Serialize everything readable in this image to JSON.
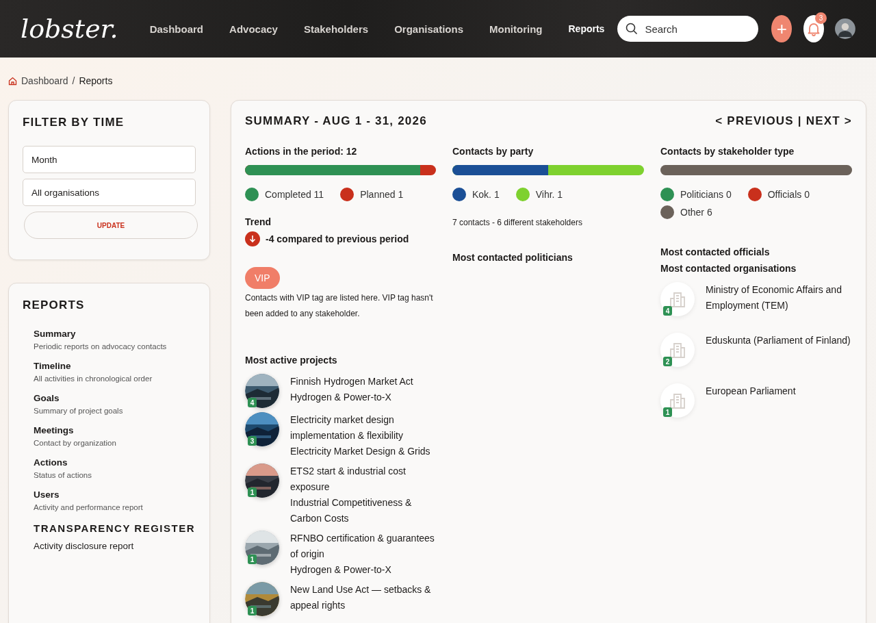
{
  "header": {
    "logo": "lobster.",
    "nav": [
      {
        "label": "Dashboard",
        "selected": false
      },
      {
        "label": "Advocacy",
        "selected": false
      },
      {
        "label": "Stakeholders",
        "selected": false
      },
      {
        "label": "Organisations",
        "selected": false
      },
      {
        "label": "Monitoring",
        "selected": false
      },
      {
        "label": "Reports",
        "selected": true
      }
    ],
    "search": {
      "placeholder": "Search"
    },
    "add_button": "+",
    "notification_count": "3"
  },
  "breadcrumb": [
    "Dashboard",
    "/",
    "Reports"
  ],
  "filter": {
    "title": "FILTER BY TIME",
    "fields": [
      "Month",
      "All organisations"
    ],
    "button": "UPDATE"
  },
  "reports": {
    "title": "REPORTS",
    "items": [
      {
        "title": "Summary",
        "subtitle": "Periodic reports on advocacy contacts"
      },
      {
        "title": "Timeline",
        "subtitle": "All activities in chronological order"
      },
      {
        "title": "Goals",
        "subtitle": "Summary of project goals"
      },
      {
        "title": "Meetings",
        "subtitle": "Contact by organization"
      },
      {
        "title": "Actions",
        "subtitle": "Status of actions"
      },
      {
        "title": "Users",
        "subtitle": "Activity and performance report"
      }
    ],
    "section_title": "TRANSPARENCY REGISTER",
    "section_items": [
      "Activity disclosure report"
    ]
  },
  "summary": {
    "title": "SUMMARY - AUG 1 - 31, 2026",
    "previous": "< PREVIOUS",
    "separator": "|",
    "next": "NEXT >",
    "actions": {
      "title": "Actions in the period: 12",
      "bar": {
        "level": 0.917,
        "color": "#2e9154"
      },
      "legend": [
        {
          "label": "Completed 11",
          "color": "#2e9154"
        },
        {
          "label": "Planned 1",
          "color": "#c9301c"
        }
      ]
    },
    "trend": {
      "title": "Trend",
      "negative": true,
      "text": "-4 compared to previous period"
    },
    "vip": {
      "tag": "VIP",
      "text": "Contacts with VIP tag are listed here. VIP tag hasn't been added to any stakeholder."
    },
    "projects": {
      "title": "Most active projects",
      "items": [
        {
          "title": "Finnish Hydrogen Market Act",
          "category": "Hydrogen & Power-to-X",
          "count": "4"
        },
        {
          "title": "Electricity market design implementation & flexibility",
          "category": "Electricity Market Design & Grids",
          "count": "3"
        },
        {
          "title": "ETS2 start & industrial cost exposure",
          "category": "Industrial Competitiveness & Carbon Costs",
          "count": "1"
        },
        {
          "title": "RFNBO certification & guarantees of origin",
          "category": "Hydrogen & Power-to-X",
          "count": "1"
        },
        {
          "title": "New Land Use Act — setbacks & appeal rights",
          "count": "1"
        }
      ]
    },
    "party": {
      "title": "Contacts by party",
      "bar": {
        "level": 0.5,
        "color": "#1b4f96"
      },
      "legend": [
        {
          "label": "Kok. 1",
          "color": "#1b4f96"
        },
        {
          "label": "Vihr. 1",
          "color": "#7ed12f"
        }
      ],
      "note": "7 contacts - 6 different stakeholders"
    },
    "politicians_title": "Most contacted politicians",
    "stakeholder_types": {
      "title": "Contacts by stakeholder type",
      "bar": {
        "level": 1,
        "color": "#6b625a"
      },
      "legend": [
        {
          "label": "Politicians 0",
          "color": "#2e9154"
        },
        {
          "label": "Officials 0",
          "color": "#c9301c"
        },
        {
          "label": "Other 6",
          "color": "#6b625a"
        }
      ]
    },
    "officials_title": "Most contacted officials",
    "organisations": {
      "title": "Most contacted organisations",
      "items": [
        {
          "name": "Ministry of Economic Affairs and Employment (TEM)",
          "count": "4"
        },
        {
          "name": "Eduskunta (Parliament of Finland)",
          "count": "2"
        },
        {
          "name": "European Parliament",
          "count": "1"
        }
      ]
    }
  }
}
